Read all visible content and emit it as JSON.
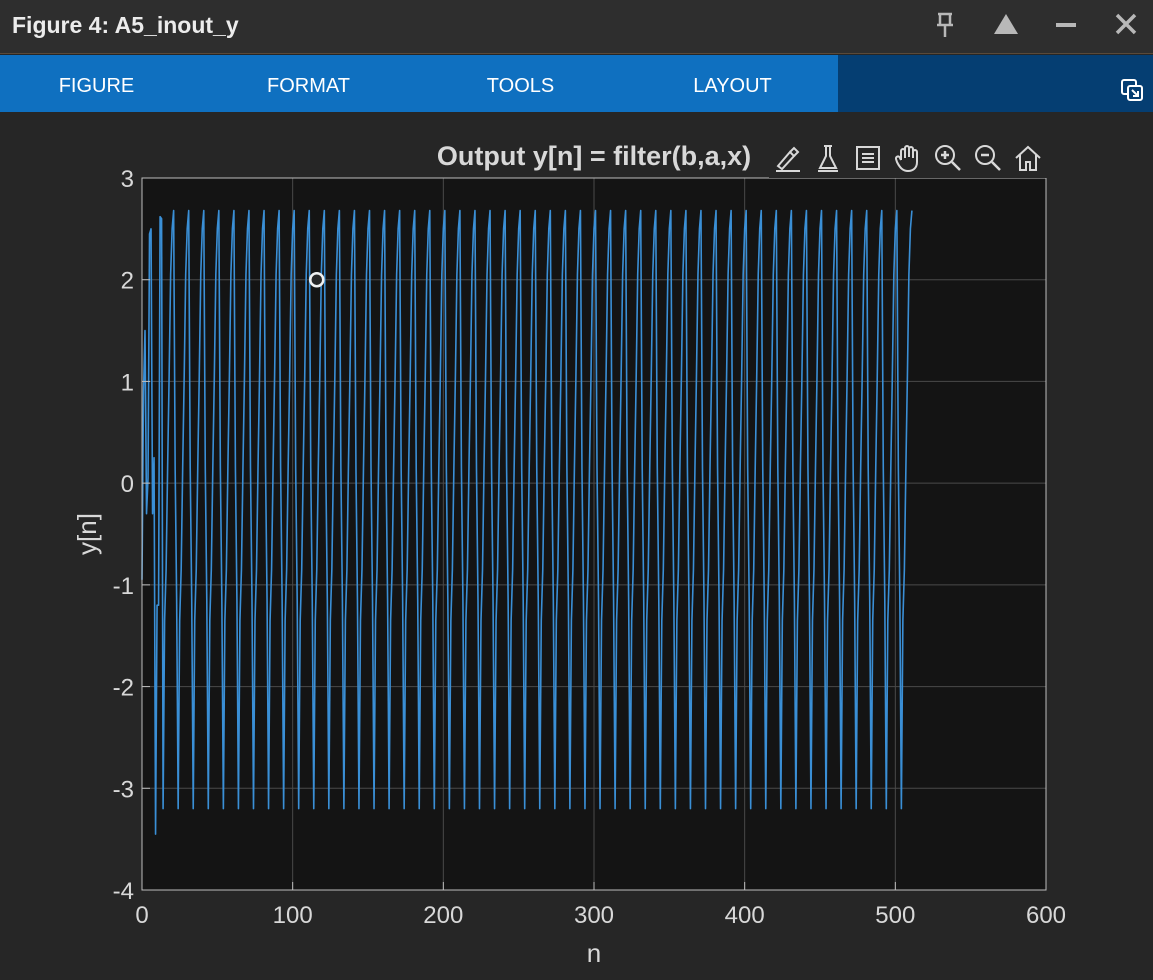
{
  "window": {
    "title": "Figure 4: A5_inout_y",
    "controls": [
      "pin-icon",
      "maximize-icon",
      "minimize-icon",
      "close-icon"
    ]
  },
  "ribbon": {
    "tabs": [
      "FIGURE",
      "FORMAT",
      "TOOLS",
      "LAYOUT"
    ],
    "undock_icon": "undock-icon"
  },
  "toolbar": {
    "tools": [
      "brush-icon",
      "data-cursor-icon",
      "legend-icon",
      "pan-icon",
      "zoom-in-icon",
      "zoom-out-icon",
      "home-icon"
    ]
  },
  "colors": {
    "background": "#262626",
    "axes_background": "#141414",
    "ribbon_tabs": "#0f70c0",
    "ribbon": "#053e72",
    "line": "#3a8fd6",
    "grid": "#4a4a4a",
    "text": "#d8d8d8"
  },
  "chart_data": {
    "type": "line",
    "title": "Output y[n] = filter(b,a,x)",
    "xlabel": "n",
    "ylabel": "y[n]",
    "xlim": [
      0,
      600
    ],
    "ylim": [
      -4,
      3
    ],
    "xticks": [
      "0",
      "100",
      "200",
      "300",
      "400",
      "500",
      "600"
    ],
    "yticks": [
      "3",
      "2",
      "1",
      "0",
      "-1",
      "-2",
      "-3",
      "-4"
    ],
    "grid": true,
    "period": 10,
    "n_start": 0,
    "n_end": 511,
    "steady_cycle": [
      -3.2,
      -1.35,
      -0.85,
      0.15,
      1.05,
      2.05,
      2.5,
      2.68,
      0.15,
      -1.15
    ],
    "initial_values": [
      -0.95,
      0.9,
      1.5,
      -0.3,
      0.05,
      2.45,
      2.5,
      -0.3,
      0.25,
      -3.45,
      -1.2,
      -1.2,
      2.62,
      2.6
    ],
    "datatip": {
      "x": 116,
      "y": 2
    }
  }
}
